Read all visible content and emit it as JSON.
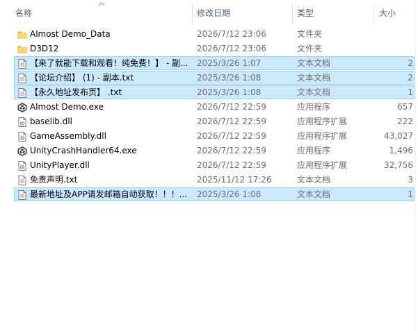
{
  "columns": {
    "name": "名称",
    "date": "修改日期",
    "type": "类型",
    "size": "大小"
  },
  "sort": {
    "column": "name",
    "direction": "ascending"
  },
  "colors": {
    "selection_bg": "#cce8ff",
    "selection_border": "#99d1ff",
    "folder": "#f8d775",
    "header_text": "#4c607a",
    "secondary_text": "#6d6d6d"
  },
  "files": [
    {
      "name": "Almost Demo_Data",
      "date": "2026/7/12 23:06",
      "type": "文件夹",
      "size": "",
      "icon": "folder-icon",
      "selected": false
    },
    {
      "name": "D3D12",
      "date": "2026/7/12 23:06",
      "type": "文件夹",
      "size": "",
      "icon": "folder-icon",
      "selected": false
    },
    {
      "name": "【来了就能下载和观看！纯免费！】 - 副...",
      "date": "2025/3/26 1:07",
      "type": "文本文档",
      "size": "2",
      "icon": "text-file-icon",
      "selected": true
    },
    {
      "name": "【论坛介绍】 (1) - 副本.txt",
      "date": "2025/3/26 1:08",
      "type": "文本文档",
      "size": "2",
      "icon": "text-file-icon",
      "selected": true
    },
    {
      "name": "【永久地址发布页】 .txt",
      "date": "2025/3/26 1:08",
      "type": "文本文档",
      "size": "1",
      "icon": "text-file-icon",
      "selected": true
    },
    {
      "name": "Almost Demo.exe",
      "date": "2026/7/12 22:59",
      "type": "应用程序",
      "size": "657",
      "icon": "unity-app-icon",
      "selected": false
    },
    {
      "name": "baselib.dll",
      "date": "2026/7/12 22:59",
      "type": "应用程序扩展",
      "size": "222",
      "icon": "dll-file-icon",
      "selected": false
    },
    {
      "name": "GameAssembly.dll",
      "date": "2026/7/12 22:59",
      "type": "应用程序扩展",
      "size": "43,027",
      "icon": "dll-file-icon",
      "selected": false
    },
    {
      "name": "UnityCrashHandler64.exe",
      "date": "2026/7/12 22:59",
      "type": "应用程序",
      "size": "1,496",
      "icon": "unity-app-icon",
      "selected": false
    },
    {
      "name": "UnityPlayer.dll",
      "date": "2026/7/12 22:59",
      "type": "应用程序扩展",
      "size": "32,756",
      "icon": "dll-file-icon",
      "selected": false
    },
    {
      "name": "免责声明.txt",
      "date": "2025/11/12 17:26",
      "type": "文本文档",
      "size": "3",
      "icon": "text-file-icon",
      "selected": false
    },
    {
      "name": "最新地址及APP请发邮箱自动获取！！！...",
      "date": "2025/3/26 1:08",
      "type": "文本文档",
      "size": "1",
      "icon": "text-file-icon",
      "selected": true
    }
  ]
}
